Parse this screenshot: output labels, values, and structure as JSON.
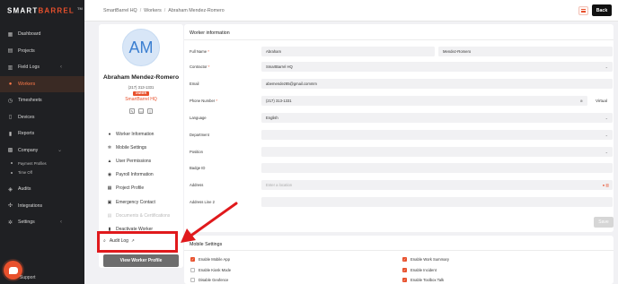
{
  "brand": {
    "logo_part1": "SMART",
    "logo_part2": "BARREL",
    "logo_suffix": "TM",
    "accent": "#e8502c"
  },
  "sidebar": {
    "items": [
      {
        "label": "Dashboard",
        "icon": "dashboard-icon"
      },
      {
        "label": "Projects",
        "icon": "briefcase-icon"
      },
      {
        "label": "Field Logs",
        "icon": "clipboard-icon",
        "chevron": "‹"
      },
      {
        "label": "Workers",
        "icon": "users-icon",
        "active": true
      },
      {
        "label": "Timesheets",
        "icon": "clock-icon"
      },
      {
        "label": "Devices",
        "icon": "tablet-icon"
      },
      {
        "label": "Reports",
        "icon": "chart-icon"
      },
      {
        "label": "Company",
        "icon": "building-icon",
        "chevron": "⌄"
      }
    ],
    "sub_items": [
      {
        "label": "Payment Profiles"
      },
      {
        "label": "Time Off"
      }
    ],
    "items_after": [
      {
        "label": "Audits",
        "icon": "shield-icon"
      },
      {
        "label": "Integrations",
        "icon": "plug-icon"
      },
      {
        "label": "Settings",
        "icon": "gear-icon",
        "chevron": "‹"
      }
    ],
    "support_label": "Support"
  },
  "breadcrumb": {
    "items": [
      "SmartBarrel HQ",
      "Workers",
      "Abraham Mendez-Romero"
    ],
    "separator": "/"
  },
  "header": {
    "back_label": "Back"
  },
  "profile": {
    "initials": "AM",
    "name": "Abraham Mendez-Romero",
    "phone": "(217) 313-1331",
    "badge": "OWNER",
    "company": "SmartBarrel HQ",
    "menu": [
      {
        "label": "Worker Information",
        "icon": "person-icon",
        "glyph": "●"
      },
      {
        "label": "Mobile Settings",
        "icon": "gear-icon",
        "glyph": "✲"
      },
      {
        "label": "User Permissions",
        "icon": "lock-icon",
        "glyph": "▲"
      },
      {
        "label": "Payroll Information",
        "icon": "payroll-icon",
        "glyph": "◉"
      },
      {
        "label": "Project Profile",
        "icon": "folder-icon",
        "glyph": "▦"
      },
      {
        "label": "Emergency Contact",
        "icon": "contact-icon",
        "glyph": "▣"
      },
      {
        "label": "Documents & Certifications",
        "icon": "document-icon",
        "glyph": "▤",
        "disabled": true
      },
      {
        "label": "Deactivate Worker",
        "icon": "trash-icon",
        "glyph": "▮"
      }
    ],
    "audit_label": "Audit Log",
    "view_profile_label": "View Worker Profile"
  },
  "worker_info": {
    "title": "Worker information",
    "full_name_label": "Full Name",
    "first_name": "Abraham",
    "last_name": "Mendez-Romero",
    "contractor_label": "Contractor",
    "contractor": "SmartBarrel HQ",
    "email_label": "Email",
    "email": "abemendez85@gmail.commm",
    "phone_label": "Phone Number",
    "phone": "(217) 313-1331",
    "virtual_label": "Virtual",
    "language_label": "Language",
    "language": "English",
    "department_label": "Department",
    "position_label": "Position",
    "badge_id_label": "Badge ID",
    "address_label": "Address",
    "address_placeholder": "Enter a location",
    "address2_label": "Address Line 2",
    "save_label": "Save"
  },
  "mobile_settings": {
    "title": "Mobile Settings",
    "left": [
      {
        "label": "Enable Mobile App",
        "checked": true
      },
      {
        "label": "Enable Kiosk Mode",
        "checked": false
      },
      {
        "label": "Disable Geofence",
        "checked": false
      }
    ],
    "right": [
      {
        "label": "Enable Work Summary",
        "checked": true
      },
      {
        "label": "Enable Incident",
        "checked": true
      },
      {
        "label": "Enable Toolbox Talk",
        "checked": true
      }
    ]
  },
  "annotation": {
    "color": "#e0191c"
  }
}
